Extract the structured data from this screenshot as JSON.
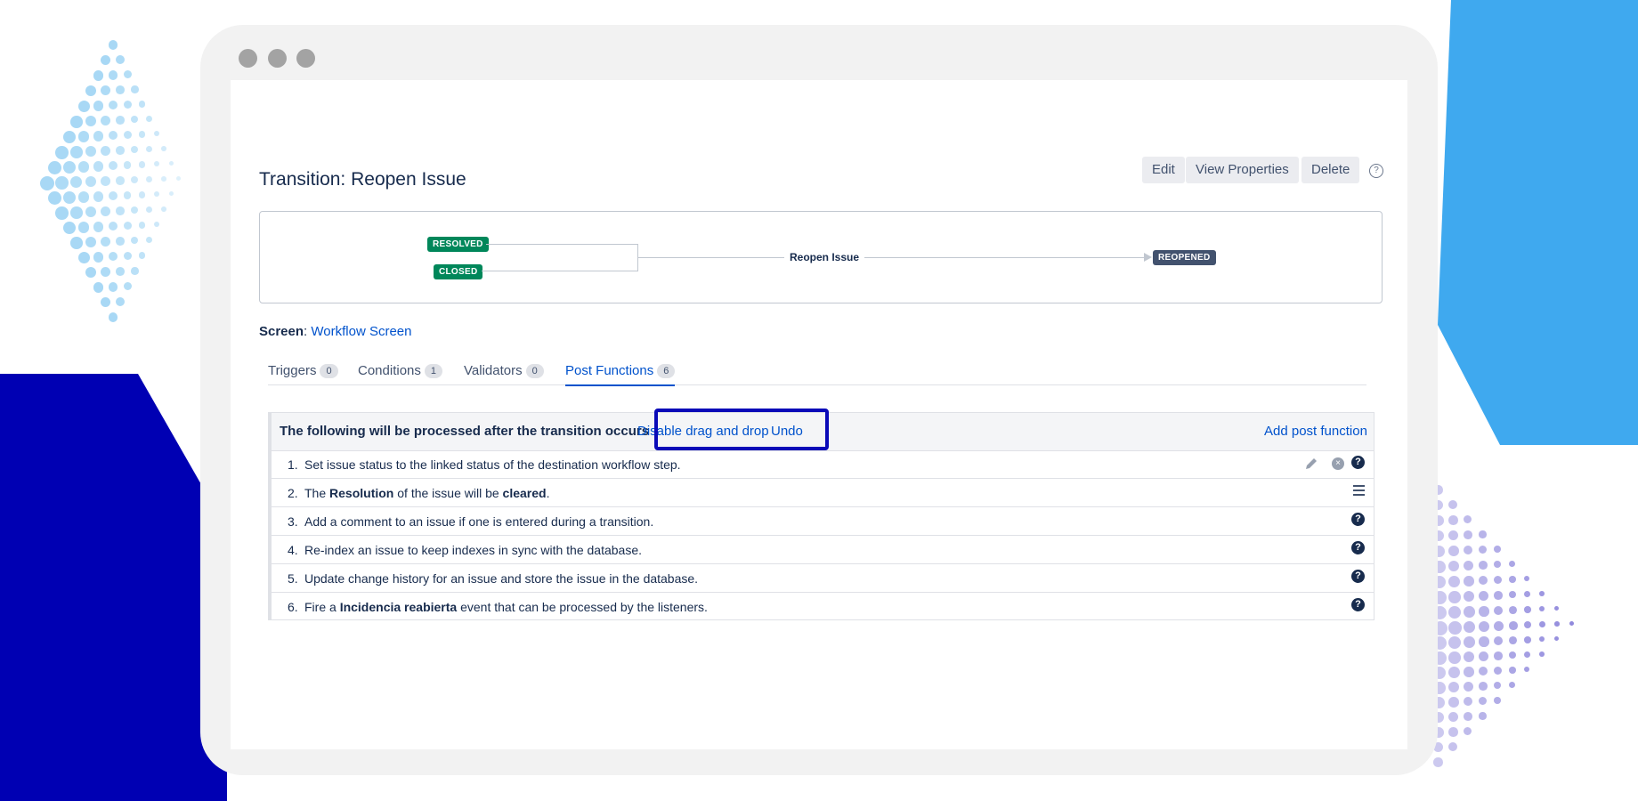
{
  "colors": {
    "left_shape": "#0000b3",
    "right_shape": "#3fa9ef",
    "dots_left": "#a8d8f5",
    "dots_right": "#8f88dc",
    "highlight": "#0a0ab8",
    "status_green": "#00875a",
    "status_dark": "#42526e",
    "link": "#0052cc"
  },
  "page": {
    "title": "Transition: Reopen Issue"
  },
  "actions": {
    "edit": "Edit",
    "view_properties": "View Properties",
    "delete": "Delete",
    "help_icon": "?"
  },
  "diagram": {
    "from_statuses": [
      "RESOLVED",
      "CLOSED"
    ],
    "transition_name": "Reopen Issue",
    "to_status": "REOPENED"
  },
  "screen": {
    "label": "Screen",
    "separator": ":",
    "value": "Workflow Screen"
  },
  "tabs": [
    {
      "label": "Triggers",
      "count": "0",
      "active": false
    },
    {
      "label": "Conditions",
      "count": "1",
      "active": false
    },
    {
      "label": "Validators",
      "count": "0",
      "active": false
    },
    {
      "label": "Post Functions",
      "count": "6",
      "active": true
    }
  ],
  "post_functions": {
    "header": "The following will be processed after the transition occurs",
    "disable_drag": "Disable drag and drop",
    "undo": "Undo",
    "add": "Add post function",
    "rows": [
      {
        "num": "1.",
        "parts": [
          "Set issue status to the linked status of the destination workflow step."
        ]
      },
      {
        "num": "2.",
        "parts": [
          "The ",
          "Resolution",
          " of the issue will be ",
          "cleared",
          "."
        ]
      },
      {
        "num": "3.",
        "parts": [
          "Add a comment to an issue if one is entered during a transition."
        ]
      },
      {
        "num": "4.",
        "parts": [
          "Re-index an issue to keep indexes in sync with the database."
        ]
      },
      {
        "num": "5.",
        "parts": [
          "Update change history for an issue and store the issue in the database."
        ]
      },
      {
        "num": "6.",
        "parts": [
          "Fire a ",
          "Incidencia reabierta",
          " event that can be processed by the listeners."
        ]
      }
    ],
    "icons": {
      "question": "?",
      "delete": "×"
    }
  }
}
